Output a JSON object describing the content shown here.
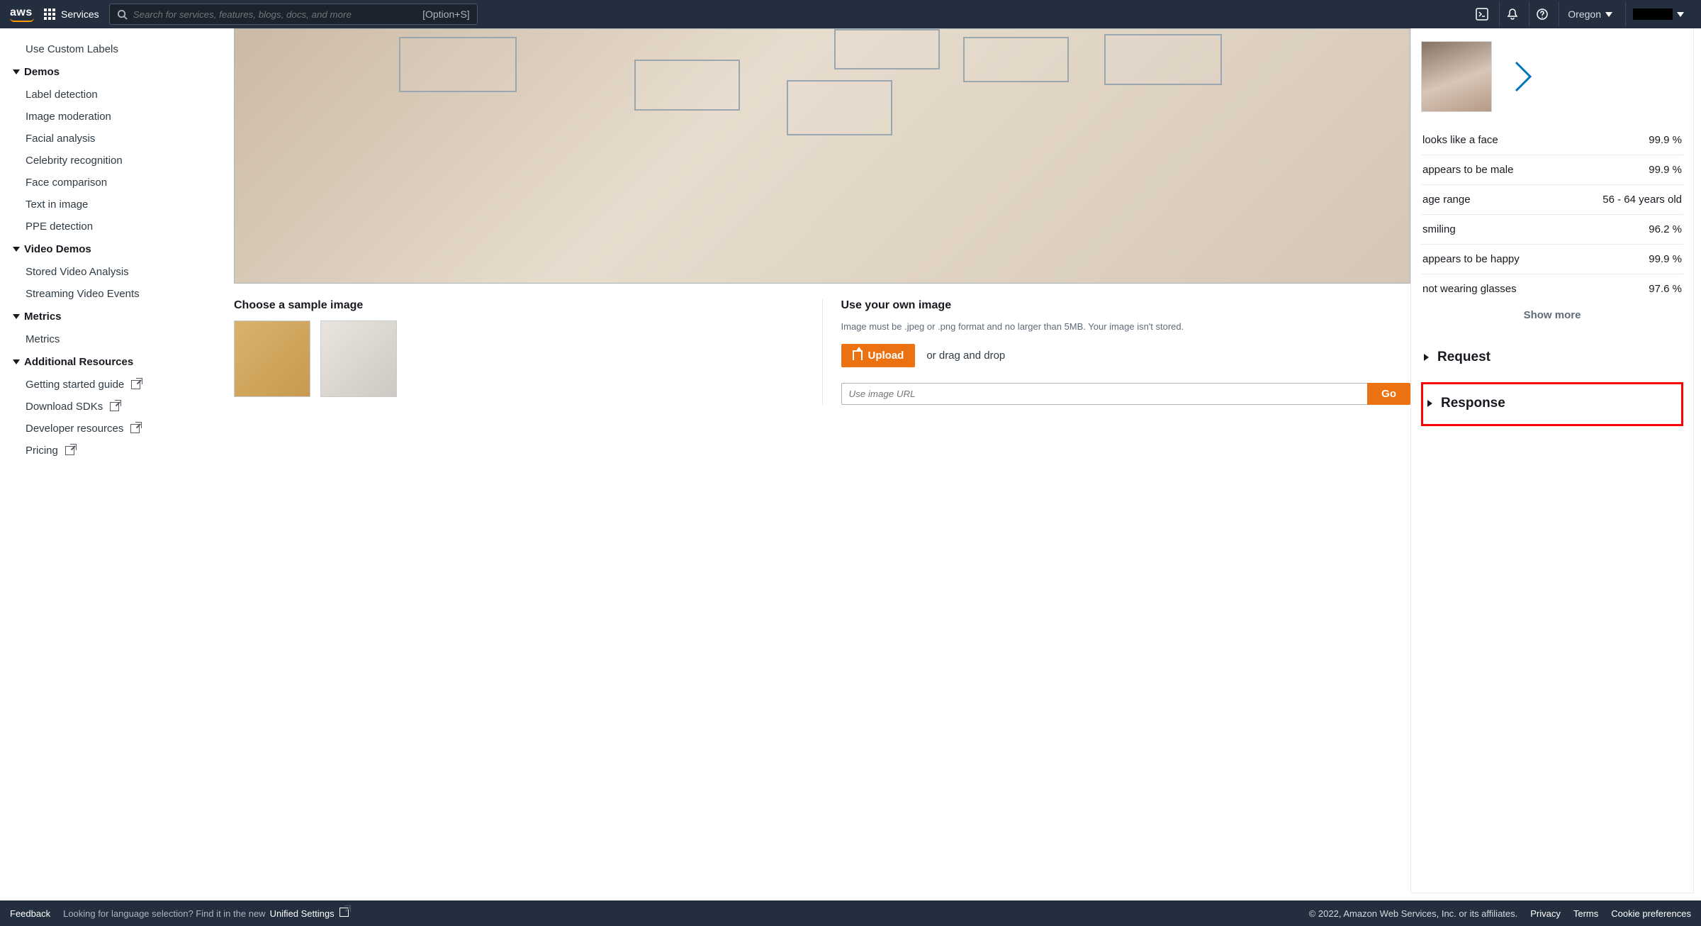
{
  "nav": {
    "services_label": "Services",
    "search_placeholder": "Search for services, features, blogs, docs, and more",
    "search_hint": "[Option+S]",
    "region": "Oregon"
  },
  "sidebar": {
    "item_custom_labels": "Use Custom Labels",
    "group_demos": "Demos",
    "demos": {
      "label_detection": "Label detection",
      "image_moderation": "Image moderation",
      "facial_analysis": "Facial analysis",
      "celebrity_recognition": "Celebrity recognition",
      "face_comparison": "Face comparison",
      "text_in_image": "Text in image",
      "ppe_detection": "PPE detection"
    },
    "group_video_demos": "Video Demos",
    "video": {
      "stored": "Stored Video Analysis",
      "streaming": "Streaming Video Events"
    },
    "group_metrics": "Metrics",
    "metrics_item": "Metrics",
    "group_additional": "Additional Resources",
    "additional": {
      "getting_started": "Getting started guide",
      "download_sdks": "Download SDKs",
      "dev_resources": "Developer resources",
      "pricing": "Pricing"
    }
  },
  "center": {
    "choose_sample": "Choose a sample image",
    "use_own": "Use your own image",
    "own_note": "Image must be .jpeg or .png format and no larger than 5MB. Your image isn't stored.",
    "upload_label": "Upload",
    "drag_text": "or drag and drop",
    "url_placeholder": "Use image URL",
    "go_label": "Go"
  },
  "results": {
    "attrs": [
      {
        "label": "looks like a face",
        "value": "99.9 %"
      },
      {
        "label": "appears to be male",
        "value": "99.9 %"
      },
      {
        "label": "age range",
        "value": "56 - 64 years old"
      },
      {
        "label": "smiling",
        "value": "96.2 %"
      },
      {
        "label": "appears to be happy",
        "value": "99.9 %"
      },
      {
        "label": "not wearing glasses",
        "value": "97.6 %"
      }
    ],
    "show_more": "Show more",
    "request_label": "Request",
    "response_label": "Response"
  },
  "footer": {
    "feedback": "Feedback",
    "lang_note_pre": "Looking for language selection? Find it in the new ",
    "lang_note_link": "Unified Settings",
    "copyright": "© 2022, Amazon Web Services, Inc. or its affiliates.",
    "privacy": "Privacy",
    "terms": "Terms",
    "cookie": "Cookie preferences"
  }
}
